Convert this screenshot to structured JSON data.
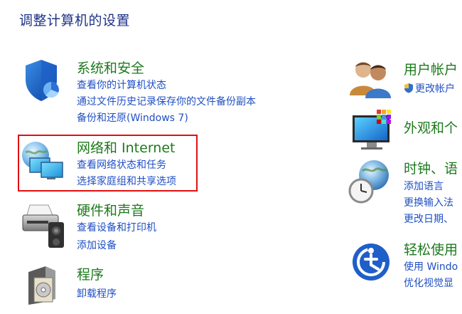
{
  "page": {
    "title": "调整计算机的设置"
  },
  "left": {
    "security": {
      "title": "系统和安全",
      "links": [
        "查看你的计算机状态",
        "通过文件历史记录保存你的文件备份副本",
        "备份和还原(Windows 7)"
      ],
      "icon": "shield-icon"
    },
    "network": {
      "title": "网络和 Internet",
      "links": [
        "查看网络状态和任务",
        "选择家庭组和共享选项"
      ],
      "icon": "network-globe-icon"
    },
    "hardware": {
      "title": "硬件和声音",
      "links": [
        "查看设备和打印机",
        "添加设备"
      ],
      "icon": "printer-icon"
    },
    "programs": {
      "title": "程序",
      "links": [
        "卸载程序"
      ],
      "icon": "programs-icon"
    }
  },
  "right": {
    "users": {
      "title": "用户帐户",
      "links": [
        "更改帐户"
      ],
      "icon": "users-icon"
    },
    "appearance": {
      "title": "外观和个",
      "links": [],
      "icon": "display-icon"
    },
    "clock": {
      "title": "时钟、语",
      "links": [
        "添加语言",
        "更换输入法",
        "更改日期、"
      ],
      "icon": "clock-globe-icon"
    },
    "ease": {
      "title": "轻松使用",
      "links": [
        "使用 Windo",
        "优化视觉显"
      ],
      "icon": "ease-of-access-icon"
    }
  },
  "colors": {
    "category_title": "#1d7a1d",
    "link": "#1f4fc4",
    "page_title": "#1e3287",
    "highlight": "#e01010"
  }
}
